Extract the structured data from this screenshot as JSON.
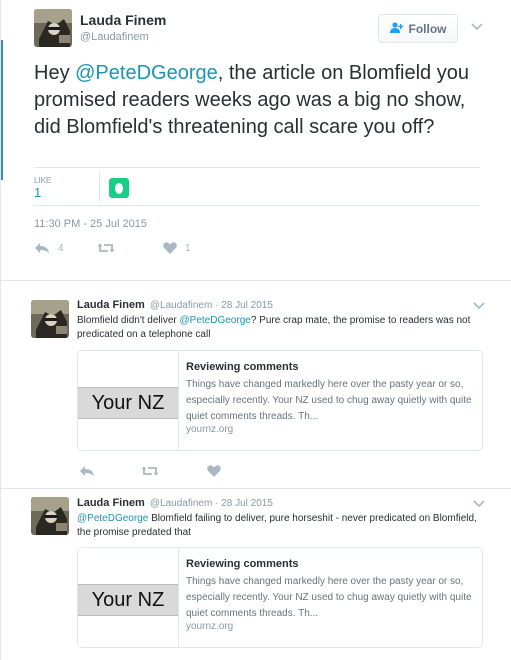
{
  "main_tweet": {
    "author_name": "Lauda Finem",
    "author_handle": "@Laudafinem",
    "follow_label": "Follow",
    "text_mention": "@PeteDGeorge",
    "text_pre": "Hey ",
    "text_post": ", the article on Blomfield you promised readers weeks ago was a big no show, did Blomfield's threatening call scare you off?",
    "like_label": "LIKE",
    "like_count": "1",
    "timestamp": "11:30 PM - 25 Jul 2015",
    "actions": {
      "reply_count": "4",
      "retweet_count": "",
      "like_count": "1"
    }
  },
  "replies": [
    {
      "author_name": "Lauda Finem",
      "meta": "@Laudafinem · 28 Jul 2015",
      "text_pre": "Blomfield didn't deliver ",
      "text_mention": "@PeteDGeorge",
      "text_post": "? Pure crap mate, the promise to readers was not predicated on a telephone call",
      "card": {
        "image_text": "Your NZ",
        "title": "Reviewing comments",
        "description": "Things have changed markedly here over the pasty year or so, especially recently. Your NZ used to chug away quietly with quite quiet comments threads. Th...",
        "domain": "yournz.org"
      }
    },
    {
      "author_name": "Lauda Finem",
      "meta": "@Laudafinem · 28 Jul 2015",
      "text_pre": "",
      "text_mention": "@PeteDGeorge",
      "text_post": " Blomfield failing to deliver, pure horseshit - never predicated on Blomfield, the promise predated that",
      "card": {
        "image_text": "Your NZ",
        "title": "Reviewing comments",
        "description": "Things have changed markedly here over the pasty year or so, especially recently. Your NZ used to chug away quietly with quite quiet comments threads. Th...",
        "domain": "yournz.org"
      }
    }
  ],
  "icons": {
    "follow": "add-user-icon",
    "more": "chevron-down-icon",
    "reply": "reply-icon",
    "retweet": "retweet-icon",
    "like": "heart-icon"
  },
  "colors": {
    "link": "#1b95b0",
    "muted": "#8899a6",
    "liker_avatar": "#19cf86"
  }
}
